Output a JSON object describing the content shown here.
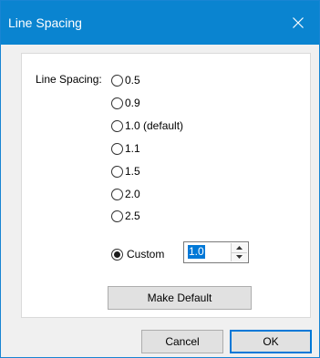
{
  "window": {
    "title": "Line Spacing",
    "close_icon": "close-icon"
  },
  "line_spacing": {
    "label": "Line Spacing:",
    "options": [
      "0.5",
      "0.9",
      "1.0 (default)",
      "1.1",
      "1.5",
      "2.0",
      "2.5"
    ],
    "custom_label": "Custom",
    "custom_value": "1.0",
    "selected": "Custom"
  },
  "buttons": {
    "make_default": "Make Default",
    "cancel": "Cancel",
    "ok": "OK"
  },
  "colors": {
    "titlebar": "#0a84d0",
    "accent": "#0078d7",
    "dialog_bg": "#f0f0f0"
  }
}
